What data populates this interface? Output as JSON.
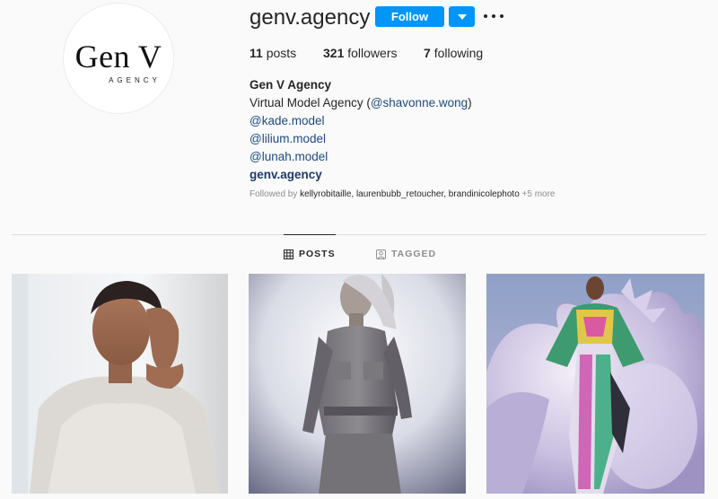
{
  "profile": {
    "username": "genv.agency",
    "logo": {
      "main": "Gen V",
      "sub": "AGENCY"
    }
  },
  "actions": {
    "follow_label": "Follow"
  },
  "stats": {
    "posts_count": "11",
    "posts_label": "posts",
    "followers_count": "321",
    "followers_label": "followers",
    "following_count": "7",
    "following_label": "following"
  },
  "bio": {
    "name": "Gen V Agency",
    "description_prefix": "Virtual Model Agency (",
    "description_mention": "@shavonne.wong",
    "description_suffix": ")",
    "mention_1": "@kade.model",
    "mention_2": "@lilium.model",
    "mention_3": "@lunah.model",
    "website": "genv.agency"
  },
  "followed_by": {
    "prefix": "Followed by",
    "names": "kellyrobitaille, laurenbubb_retoucher, brandinicolephoto",
    "more": "+5 more"
  },
  "tabs": {
    "posts": "POSTS",
    "tagged": "TAGGED"
  },
  "colors": {
    "accent": "#0095f6",
    "link": "#1e4a7e",
    "muted": "#8e8e8e",
    "background": "#fafafa"
  },
  "icons": [
    "chevron-down-icon",
    "more-icon",
    "grid-icon",
    "tagged-icon"
  ]
}
